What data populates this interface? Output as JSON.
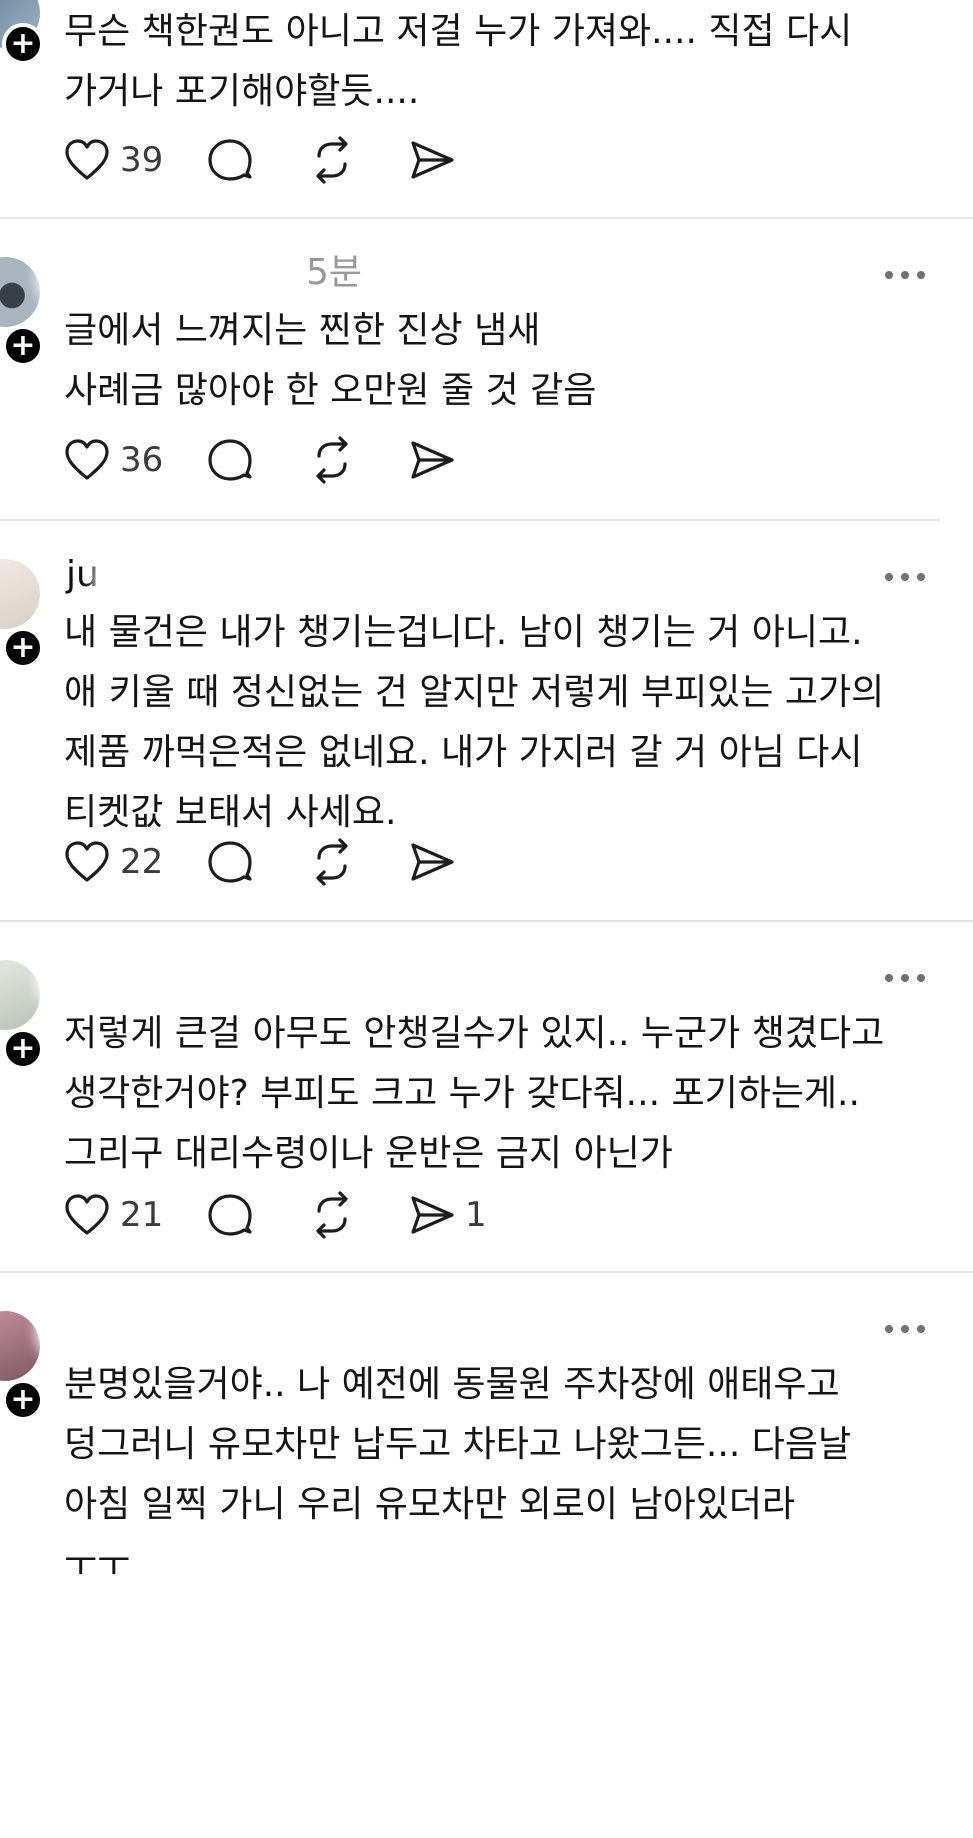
{
  "posts": [
    {
      "author": "",
      "time": "",
      "text": "무슨 책한권도 아니고 저걸 누가 가져와.... 직접 다시\n가거나 포기해야할듯....",
      "likes": "39",
      "shares": ""
    },
    {
      "author": "",
      "time": "5분",
      "text": "글에서 느껴지는 찐한 진상 냄새\n사례금 많아야 한 오만원 줄 것 같음",
      "likes": "36",
      "shares": ""
    },
    {
      "author": "ju",
      "time": "",
      "text": "내 물건은 내가 챙기는겁니다. 남이 챙기는 거 아니고.\n애 키울 때 정신없는 건 알지만 저렇게 부피있는 고가의\n제품 까먹은적은 없네요. 내가 가지러 갈 거 아님 다시\n티켓값 보태서 사세요.",
      "likes": "22",
      "shares": ""
    },
    {
      "author": "",
      "time": "",
      "text": "저렇게 큰걸 아무도 안챙길수가 있지.. 누군가 챙겼다고\n생각한거야? 부피도 크고 누가 갖다줘... 포기하는게..\n그리구 대리수령이나 운반은 금지 아닌가",
      "likes": "21",
      "shares": "1"
    },
    {
      "author": "",
      "time": "",
      "text": "분명있을거야.. 나 예전에 동물원 주차장에 애태우고\n덩그러니 유모차만 납두고 차타고 나왔그든... 다음날\n아침 일찍 가니 우리 유모차만 외로이 남아있더라\nㅜㅜ",
      "likes": "",
      "shares": ""
    }
  ],
  "icons": {
    "like": "heart-icon",
    "reply": "speech-bubble-icon",
    "repost": "repost-icon",
    "share": "send-icon",
    "more": "more-dots-icon",
    "follow": "plus-icon"
  }
}
